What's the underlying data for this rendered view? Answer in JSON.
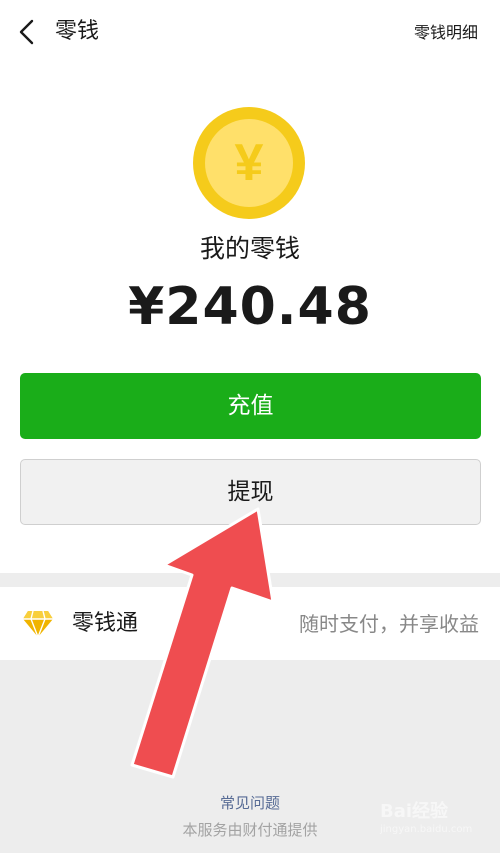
{
  "header": {
    "back_icon": "chevron-left-icon",
    "title": "零钱",
    "detail_link": "零钱明细"
  },
  "wallet": {
    "coin_icon": "yen-coin-icon",
    "coin_symbol": "¥",
    "balance_label": "我的零钱",
    "balance_amount": "¥240.48"
  },
  "actions": {
    "recharge_label": "充值",
    "withdraw_label": "提现"
  },
  "fund": {
    "icon": "diamond-icon",
    "name": "零钱通",
    "description": "随时支付，并享收益"
  },
  "footer": {
    "faq": "常见问题",
    "provider": "本服务由财付通提供"
  },
  "watermark": {
    "text": "Bai经验",
    "sub": "jingyan.baidu.com"
  },
  "colors": {
    "primary_green": "#1aad19",
    "coin_gold": "#f5cb1b",
    "arrow_red": "#ef4d50",
    "link_blue": "#576b95"
  }
}
